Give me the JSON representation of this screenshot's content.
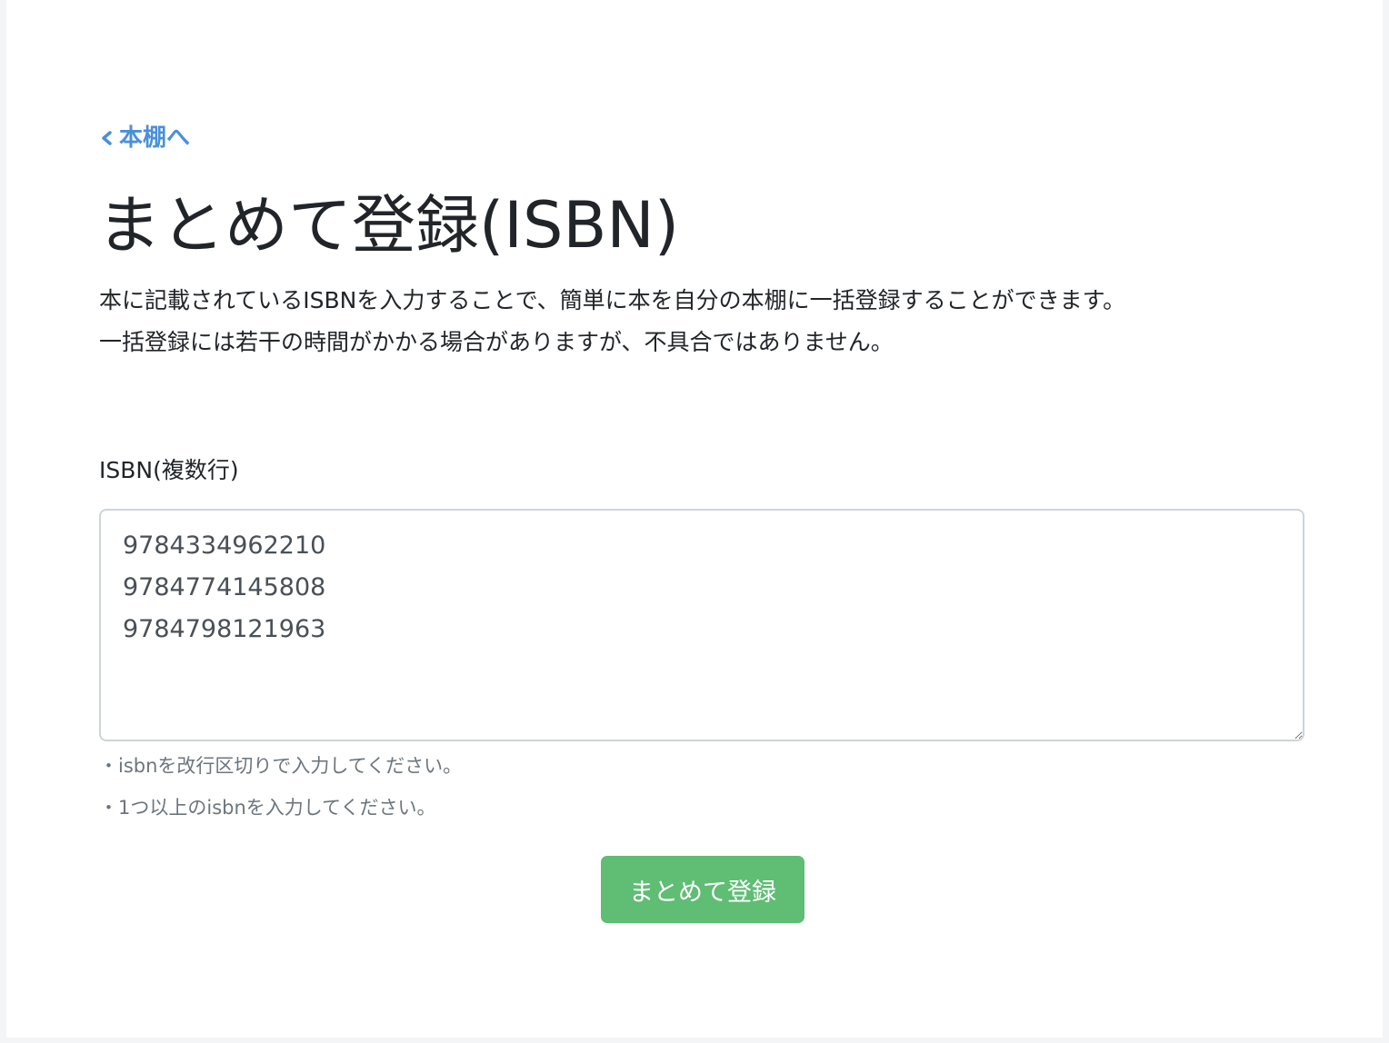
{
  "nav": {
    "back_label": "本棚へ"
  },
  "page": {
    "title": "まとめて登録(ISBN)",
    "description_line1": "本に記載されているISBNを入力することで、簡単に本を自分の本棚に一括登録することができます。",
    "description_line2": "一括登録には若干の時間がかかる場合がありますが、不具合ではありません。"
  },
  "form": {
    "isbn_label": "ISBN(複数行)",
    "isbn_value": "9784334962210\n9784774145808\n9784798121963",
    "hints": [
      "・isbnを改行区切りで入力してください。",
      "・1つ以上のisbnを入力してください。"
    ],
    "submit_label": "まとめて登録"
  },
  "colors": {
    "link": "#4a90d9",
    "submit": "#5fbd74",
    "hint_text": "#6c757d"
  },
  "icons": {
    "back": "chevron-left-icon"
  }
}
